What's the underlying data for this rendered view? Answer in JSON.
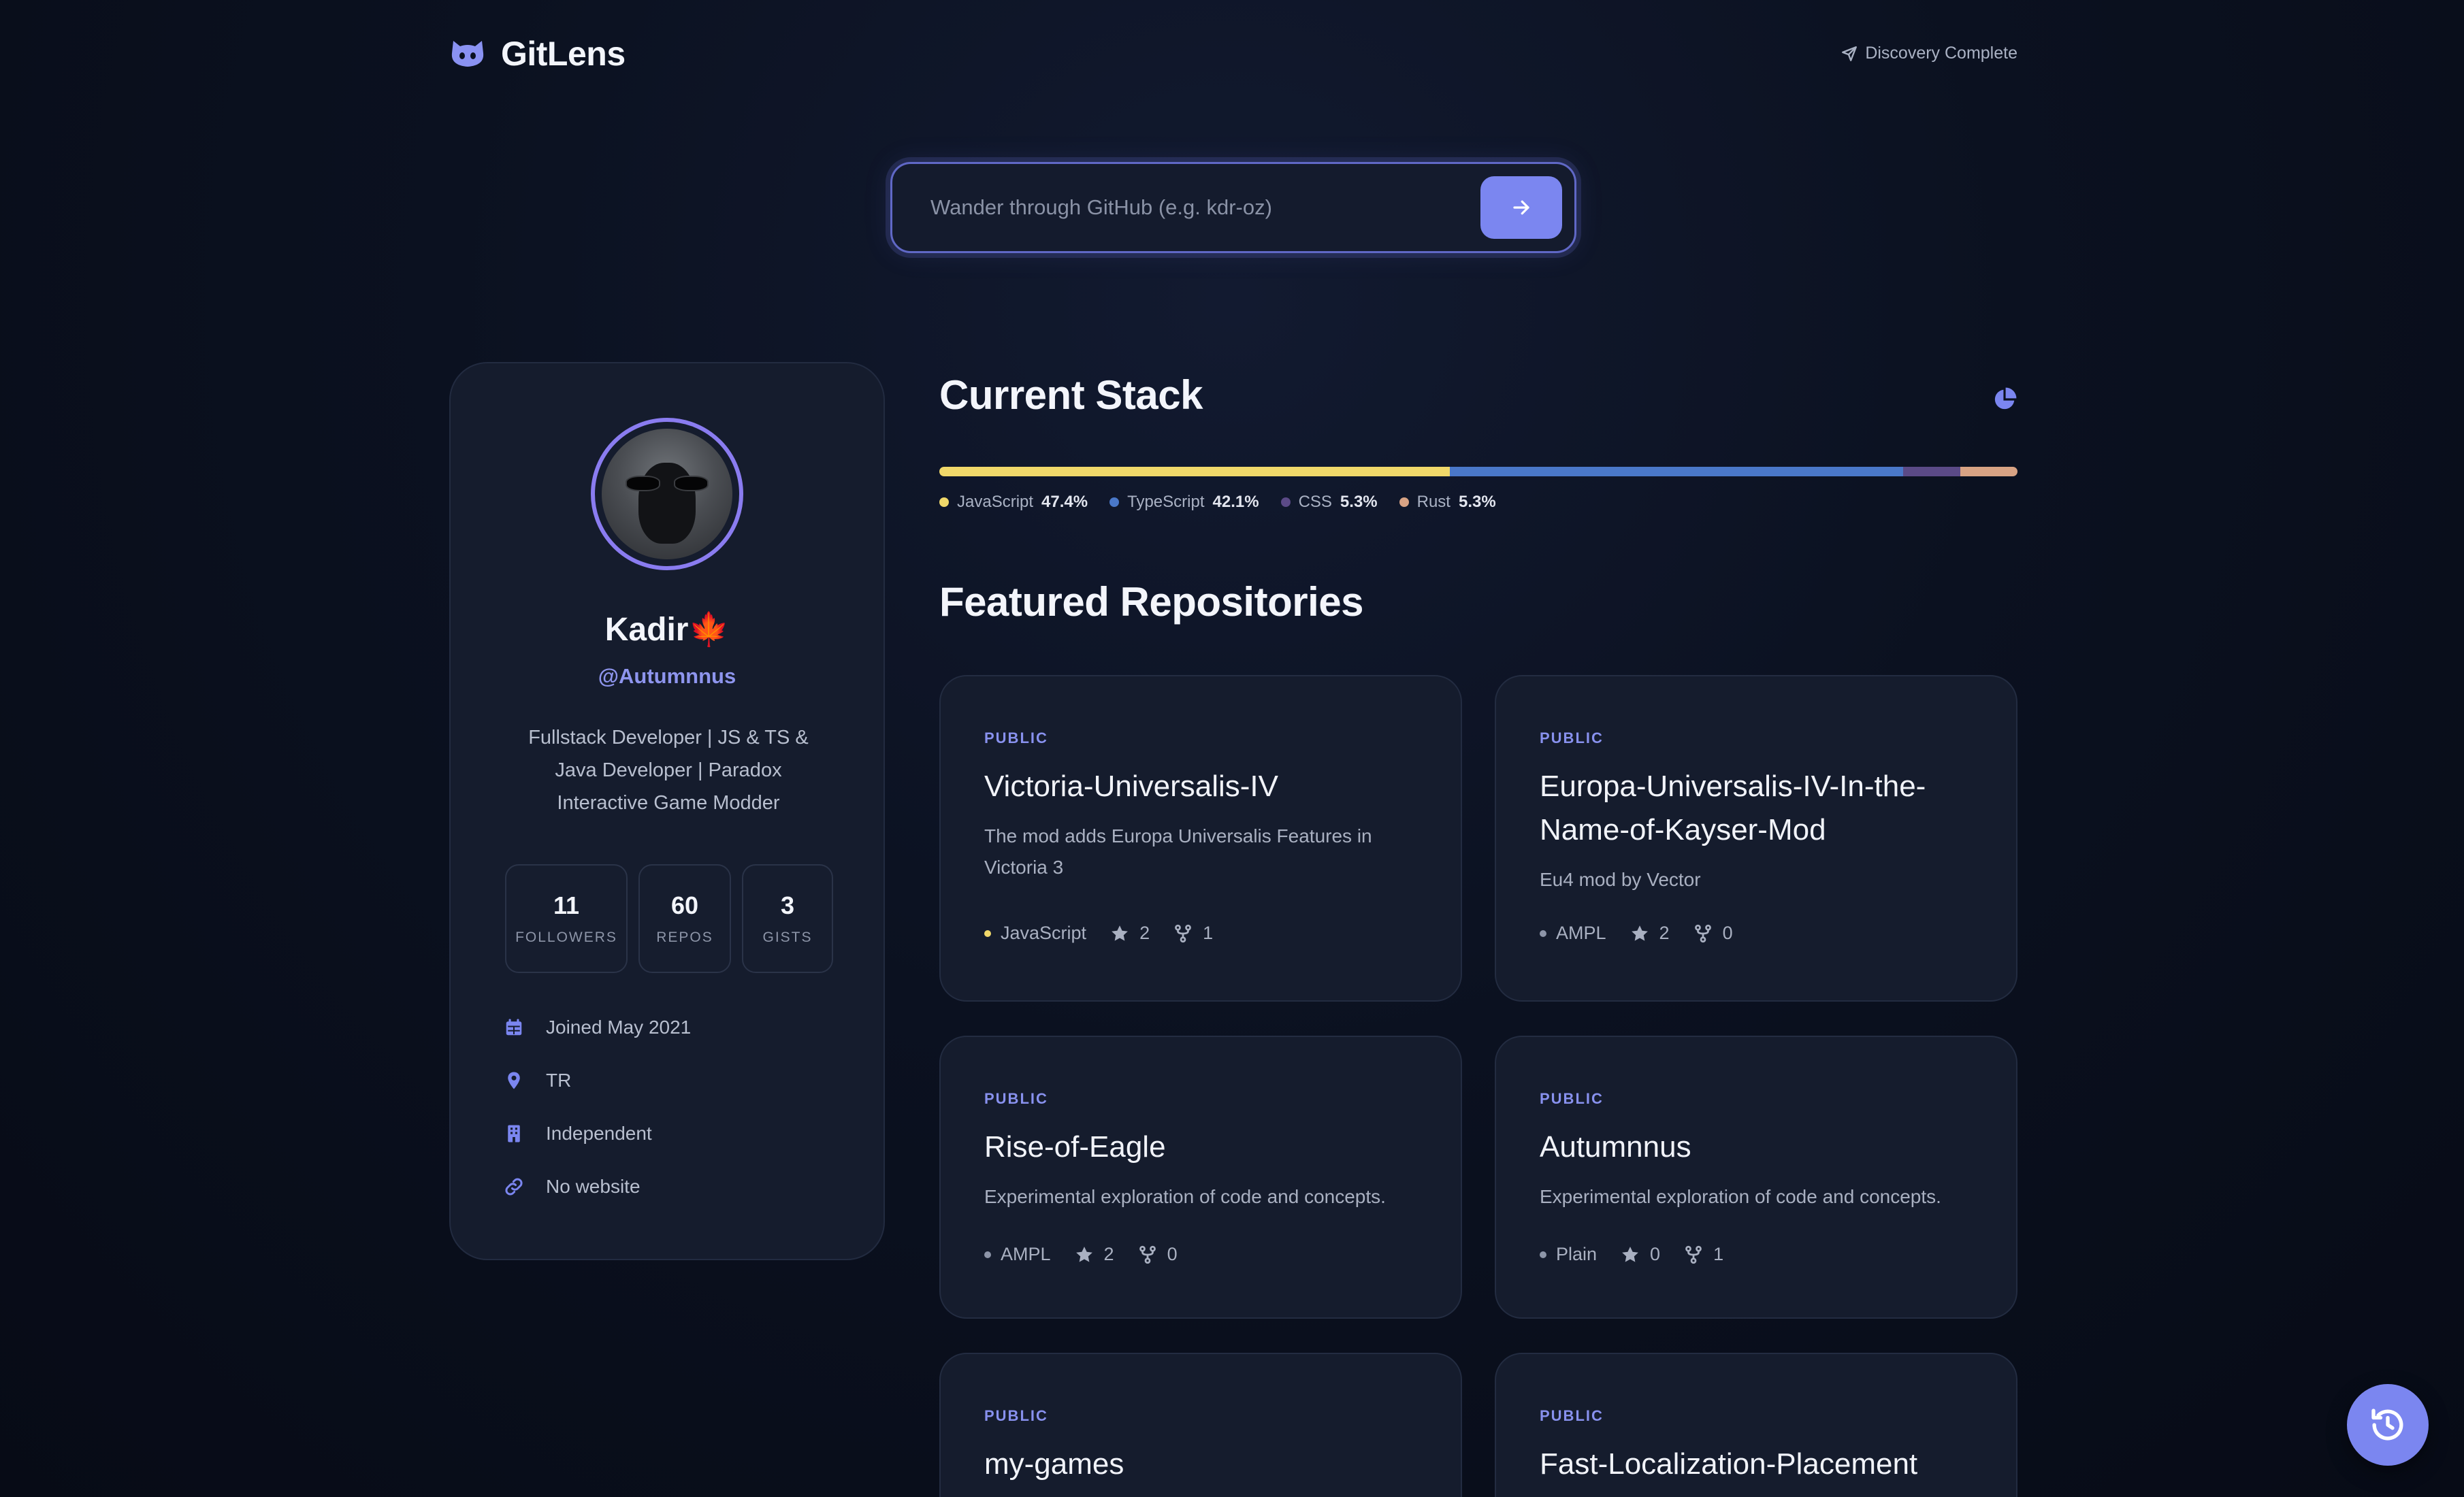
{
  "header": {
    "brand": "GitLens",
    "status": "Discovery Complete"
  },
  "search": {
    "placeholder": "Wander through GitHub (e.g. kdr-oz)"
  },
  "profile": {
    "name": "Kadir🍁",
    "handle": "@Autumnnus",
    "bio": "Fullstack Developer | JS & TS & Java Developer | Paradox Interactive Game Modder",
    "stats": [
      {
        "value": "11",
        "label": "FOLLOWERS"
      },
      {
        "value": "60",
        "label": "REPOS"
      },
      {
        "value": "3",
        "label": "GISTS"
      }
    ],
    "info": [
      {
        "icon": "calendar-icon",
        "text": "Joined May 2021"
      },
      {
        "icon": "location-pin-icon",
        "text": "TR"
      },
      {
        "icon": "building-icon",
        "text": "Independent"
      },
      {
        "icon": "link-icon",
        "text": "No website"
      }
    ]
  },
  "stack": {
    "title": "Current Stack",
    "languages": [
      {
        "name": "JavaScript",
        "percent": "47.4%",
        "value": 47.4,
        "color": "#f0d86a"
      },
      {
        "name": "TypeScript",
        "percent": "42.1%",
        "value": 42.1,
        "color": "#4a78c9"
      },
      {
        "name": "CSS",
        "percent": "5.3%",
        "value": 5.3,
        "color": "#5b4a87"
      },
      {
        "name": "Rust",
        "percent": "5.3%",
        "value": 5.3,
        "color": "#d8a384"
      }
    ]
  },
  "repos": {
    "title": "Featured Repositories",
    "items": [
      {
        "visibility": "PUBLIC",
        "name": "Victoria-Universalis-IV",
        "description": "The mod adds Europa Universalis Features in Victoria 3",
        "language": "JavaScript",
        "lang_color": "#f0d86a",
        "stars": "2",
        "forks": "1"
      },
      {
        "visibility": "PUBLIC",
        "name": "Europa-Universalis-IV-In-the-Name-of-Kayser-Mod",
        "description": "Eu4 mod by Vector",
        "language": "AMPL",
        "lang_color": "#8d95a8",
        "stars": "2",
        "forks": "0"
      },
      {
        "visibility": "PUBLIC",
        "name": "Rise-of-Eagle",
        "description": "Experimental exploration of code and concepts.",
        "language": "AMPL",
        "lang_color": "#8d95a8",
        "stars": "2",
        "forks": "0"
      },
      {
        "visibility": "PUBLIC",
        "name": "Autumnnus",
        "description": "Experimental exploration of code and concepts.",
        "language": "Plain",
        "lang_color": "#8d95a8",
        "stars": "0",
        "forks": "1"
      },
      {
        "visibility": "PUBLIC",
        "name": "my-games"
      },
      {
        "visibility": "PUBLIC",
        "name": "Fast-Localization-Placement"
      }
    ]
  },
  "colors": {
    "accent": "#7b86f0",
    "accent_text": "#8e95ee",
    "background": "#0b1120",
    "card": "#151c2d"
  }
}
